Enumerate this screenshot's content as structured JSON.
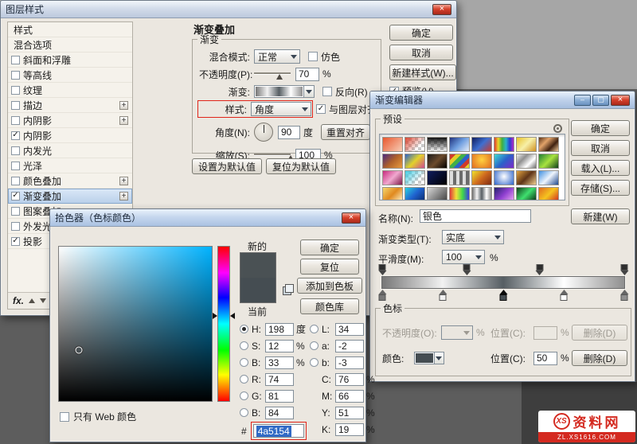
{
  "ui": {
    "annotation_color": "#e0251a"
  },
  "watermark": {
    "logo": "XS",
    "name": "资料网",
    "url": "ZL.XS1616.COM"
  },
  "layer_style": {
    "title": "图层样式",
    "fx_label": "fx.",
    "styles_list": [
      {
        "label": "样式",
        "checkbox": false,
        "checked": false,
        "plus": false,
        "selected": false
      },
      {
        "label": "混合选项",
        "checkbox": false,
        "checked": false,
        "plus": false,
        "selected": false
      },
      {
        "label": "斜面和浮雕",
        "checkbox": true,
        "checked": false,
        "plus": false,
        "selected": false
      },
      {
        "label": "等高线",
        "checkbox": true,
        "checked": false,
        "plus": false,
        "selected": false
      },
      {
        "label": "纹理",
        "checkbox": true,
        "checked": false,
        "plus": false,
        "selected": false
      },
      {
        "label": "描边",
        "checkbox": true,
        "checked": false,
        "plus": true,
        "selected": false
      },
      {
        "label": "内阴影",
        "checkbox": true,
        "checked": false,
        "plus": true,
        "selected": false
      },
      {
        "label": "内阴影",
        "checkbox": true,
        "checked": true,
        "plus": false,
        "selected": false
      },
      {
        "label": "内发光",
        "checkbox": true,
        "checked": false,
        "plus": false,
        "selected": false
      },
      {
        "label": "光泽",
        "checkbox": true,
        "checked": false,
        "plus": false,
        "selected": false
      },
      {
        "label": "颜色叠加",
        "checkbox": true,
        "checked": false,
        "plus": true,
        "selected": false
      },
      {
        "label": "渐变叠加",
        "checkbox": true,
        "checked": true,
        "plus": true,
        "selected": true
      },
      {
        "label": "图案叠加",
        "checkbox": true,
        "checked": false,
        "plus": false,
        "selected": false
      },
      {
        "label": "外发光",
        "checkbox": true,
        "checked": false,
        "plus": true,
        "selected": false
      },
      {
        "label": "投影",
        "checkbox": true,
        "checked": true,
        "plus": true,
        "selected": false
      }
    ],
    "panel": {
      "header": "渐变叠加",
      "group_label": "渐变",
      "blend_mode_label": "混合模式:",
      "blend_mode_value": "正常",
      "dither_label": "仿色",
      "opacity_label": "不透明度(P):",
      "opacity_value": "70",
      "opacity_unit": "%",
      "gradient_label": "渐变:",
      "reverse_label": "反向(R)",
      "style_label": "样式:",
      "style_value": "角度",
      "align_label": "与图层对齐(I)",
      "angle_label": "角度(N):",
      "angle_value": "90",
      "angle_unit": "度",
      "reset_align_button": "重置对齐",
      "scale_label": "缩放(S):",
      "scale_value": "100",
      "scale_unit": "%",
      "make_default_button": "设置为默认值",
      "reset_default_button": "复位为默认值"
    },
    "buttons": {
      "ok": "确定",
      "cancel": "取消",
      "new_style": "新建样式(W)...",
      "preview": "预览(V)"
    }
  },
  "gradient_editor": {
    "title": "渐变编辑器",
    "presets_label": "预设",
    "preset_gradients": [
      "linear-gradient(135deg,#e8572e,#f7cdb6)",
      "linear-gradient(135deg,#d8432f 0%,rgba(216,67,47,0) 70%),repeating-conic-gradient(#c9c9c9 0% 25%,#ffffff 0% 50%) 0 0/8px 8px",
      "linear-gradient(180deg,#111111,rgba(17,17,17,0)),repeating-conic-gradient(#c9c9c9 0% 25%,#ffffff 0% 50%) 0 0/8px 8px",
      "linear-gradient(135deg,#20327e,#6f9fe0,#e8eef8)",
      "linear-gradient(135deg,#101d5e,#3f6fd0,#c93a2c)",
      "linear-gradient(90deg,#e03a2c,#e8d32a,#3fae3f,#2ab3c9,#2a3fd0,#b32ac9)",
      "linear-gradient(135deg,#e8c22a,#f7f0a8,#cf8f1f)",
      "linear-gradient(135deg,#5e3418,#e2a36a,#3f2110,#efc898)",
      "linear-gradient(135deg,#4a2a7e,#b0622a,#e89b3f)",
      "linear-gradient(135deg,#2a62c9,#e2d22a,#cf4a92)",
      "linear-gradient(135deg,#1a1a1a,#6b4a2c,#000000)",
      "repeating-linear-gradient(135deg,#d03a2c 0 5px,#e2cf2a 5px 10px,#3fae4a 10px 15px,#2a62c9 15px 20px)",
      "radial-gradient(circle at 50% 40%,#ffd23f,#e06a1f)",
      "linear-gradient(135deg,#3fd8cf,#2a62c9,#7e2ac9)",
      "linear-gradient(135deg,#ededed,#8f8f8f,#ffffff,#6e6e6e)",
      "linear-gradient(135deg,#1f7e33,#a8e23f,#0f3f1a)",
      "linear-gradient(135deg,#c92a7e,#f0a8cf,#7e1a4a)",
      "linear-gradient(135deg,#3fc9e0 0%,rgba(63,201,224,0) 70%),repeating-conic-gradient(#c9c9c9 0% 25%,#ffffff 0% 50%) 0 0/8px 8px",
      "linear-gradient(135deg,#101d5e,#000000)",
      "repeating-linear-gradient(90deg,#dedede 0 4px,#6b6b6b 4px 8px)",
      "linear-gradient(135deg,#efe22a,#cf6a1f,#7e2a10)",
      "radial-gradient(circle at 50% 40%,#ffffff,#2a62c9)",
      "linear-gradient(135deg,#e2a33f,#5e3418,#efcf8f)",
      "linear-gradient(135deg,#3f8fe0,#eef4fc,#1f4a8f)",
      "linear-gradient(135deg,#f5d76e,#e0891f,#fdf3c8)",
      "linear-gradient(135deg,#2ad0e0,#1f62cf,#0a2a6b)",
      "linear-gradient(135deg,#d8d8d8,#3f3f3f)",
      "linear-gradient(90deg,#e03a3a,#efe23a,#3fd84a,#3a3fe0)",
      "linear-gradient(90deg,#6e6e6e,#f5f5f5,#565e63,#ffffff,#8f8f8f)",
      "linear-gradient(135deg,#23236b,#8f3fd0,#eaa8f0)",
      "linear-gradient(135deg,#0f3f1a,#3fe06e,#0a2a10)",
      "linear-gradient(135deg,#e06a1f,#f5c41f,#cf2a1f)"
    ],
    "buttons": {
      "ok": "确定",
      "cancel": "取消",
      "load": "载入(L)...",
      "save": "存储(S)..."
    },
    "name_label": "名称(N):",
    "name_value": "银色",
    "new_button": "新建(W)",
    "type_label": "渐变类型(T):",
    "type_value": "实底",
    "smoothness_label": "平滑度(M):",
    "smoothness_value": "100",
    "smoothness_unit": "%",
    "gradient_css": "linear-gradient(90deg,#777777 0%,#f2f2f2 25%,#565e63 50%,#ffffff 75%,#8f8f8f 100%)",
    "opacity_stops": [
      {
        "pos": 0
      },
      {
        "pos": 35
      },
      {
        "pos": 65
      },
      {
        "pos": 100
      }
    ],
    "color_stops": [
      {
        "pos": 0,
        "color": "#777777",
        "selected": false
      },
      {
        "pos": 25,
        "color": "#f2f2f2",
        "selected": false
      },
      {
        "pos": 50,
        "color": "#454d52",
        "selected": true
      },
      {
        "pos": 75,
        "color": "#ffffff",
        "selected": false
      },
      {
        "pos": 100,
        "color": "#8f8f8f",
        "selected": false
      }
    ],
    "stops_label": "色标",
    "stop_opacity_label": "不透明度(O):",
    "stop_opacity_value": "",
    "stop_opacity_unit": "%",
    "position_label": "位置(C):",
    "stop_position_disabled_value": "",
    "color_label": "颜色:",
    "stop_color": "#454d52",
    "stop_position_value": "50",
    "stop_position_unit": "%",
    "delete_button": "删除(D)"
  },
  "color_picker": {
    "title": "拾色器（色标颜色）",
    "new_label": "新的",
    "current_label": "当前",
    "new_color": "#4a5154",
    "current_color": "#454d52",
    "field_css": "linear-gradient(to top,#000000,rgba(0,0,0,0)),linear-gradient(to right,#ffffff,hsl(198,100%,50%))",
    "hue_css": "linear-gradient(to bottom,#ff0000,#ff00ff 17%,#0000ff 33%,#00ffff 50%,#00ff00 67%,#ffff00 83%,#ff0000)",
    "buttons": {
      "ok": "确定",
      "reset": "复位",
      "add_to_swatches": "添加到色板",
      "color_libraries": "颜色库"
    },
    "fields_left": [
      {
        "radio": true,
        "on": true,
        "label": "H:",
        "value": "198",
        "unit": "度"
      },
      {
        "radio": true,
        "on": false,
        "label": "S:",
        "value": "12",
        "unit": "%"
      },
      {
        "radio": true,
        "on": false,
        "label": "B:",
        "value": "33",
        "unit": "%"
      },
      {
        "radio": true,
        "on": false,
        "label": "R:",
        "value": "74",
        "unit": ""
      },
      {
        "radio": true,
        "on": false,
        "label": "G:",
        "value": "81",
        "unit": ""
      },
      {
        "radio": true,
        "on": false,
        "label": "B:",
        "value": "84",
        "unit": ""
      }
    ],
    "fields_right": [
      {
        "radio": true,
        "on": false,
        "label": "L:",
        "value": "34",
        "unit": ""
      },
      {
        "radio": true,
        "on": false,
        "label": "a:",
        "value": "-2",
        "unit": ""
      },
      {
        "radio": true,
        "on": false,
        "label": "b:",
        "value": "-3",
        "unit": ""
      },
      {
        "radio": false,
        "on": false,
        "label": "C:",
        "value": "76",
        "unit": "%"
      },
      {
        "radio": false,
        "on": false,
        "label": "M:",
        "value": "66",
        "unit": "%"
      },
      {
        "radio": false,
        "on": false,
        "label": "Y:",
        "value": "51",
        "unit": "%"
      },
      {
        "radio": false,
        "on": false,
        "label": "K:",
        "value": "19",
        "unit": "%"
      }
    ],
    "hex_label": "#",
    "hex_value": "4a5154",
    "web_only_label": "只有 Web 颜色"
  }
}
